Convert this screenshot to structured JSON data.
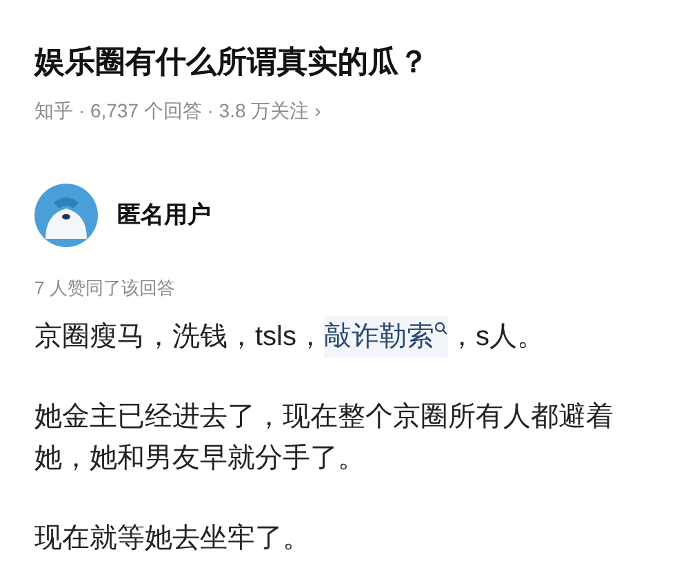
{
  "question": {
    "title": "娱乐圈有什么所谓真实的瓜？",
    "meta": "知乎 · 6,737 个回答 · 3.8 万关注",
    "meta_arrow": "›"
  },
  "answer": {
    "author": "匿名用户",
    "upvotes": "7 人赞同了该回答",
    "paragraphs": [
      {
        "segments": [
          {
            "kind": "text",
            "text": "京圈瘦马，洗钱，tsls，"
          },
          {
            "kind": "link",
            "text": "敲诈勒索"
          },
          {
            "kind": "text",
            "text": "，s人。"
          }
        ]
      },
      {
        "segments": [
          {
            "kind": "text",
            "text": "她金主已经进去了，现在整个京圈所有人都避着她，她和男友早就分手了。"
          }
        ]
      },
      {
        "segments": [
          {
            "kind": "text",
            "text": "现在就等她去坐牢了。"
          }
        ]
      }
    ]
  }
}
